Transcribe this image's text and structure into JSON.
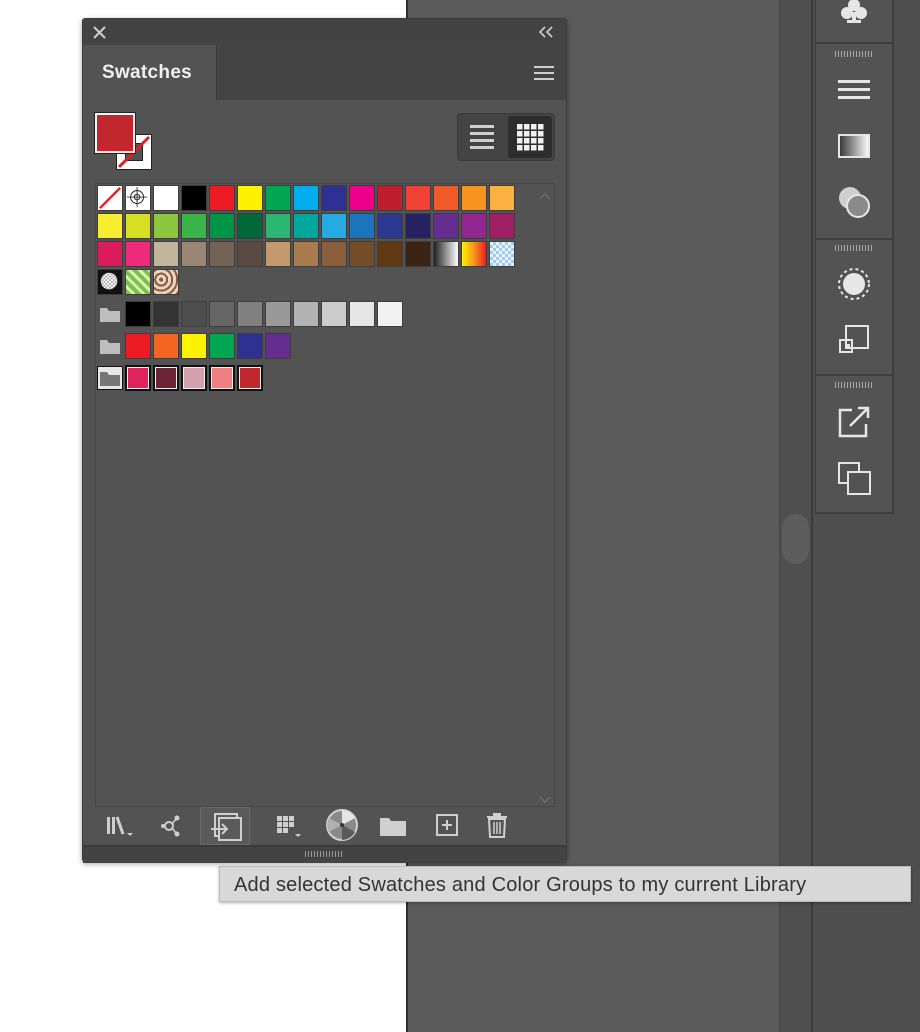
{
  "panel": {
    "title": "Swatches",
    "fill_color": "#c1272d",
    "stroke": "none"
  },
  "swatch_rows": [
    {
      "kind": "swatches",
      "colors": [
        "none",
        "registration",
        "#ffffff",
        "#000000",
        "#ed1c24",
        "#fff200",
        "#00a651",
        "#00aeef",
        "#2e3192",
        "#ec008c",
        "#be1e2d",
        "#ef4136",
        "#f15a29",
        "#f7941d",
        "#fbb040"
      ]
    },
    {
      "kind": "swatches",
      "colors": [
        "#f9ed32",
        "#d7df23",
        "#8dc63f",
        "#39b54a",
        "#009444",
        "#006838",
        "#2bb673",
        "#00a79d",
        "#27aae1",
        "#1c75bc",
        "#2b3990",
        "#262262",
        "#662d91",
        "#92278f",
        "#9e1f63"
      ]
    },
    {
      "kind": "swatches",
      "colors": [
        "#da1c5c",
        "#ee2a7b",
        "#c2b59b",
        "#998675",
        "#736357",
        "#594a42",
        "#c49a6c",
        "#a97c50",
        "#8b5e3c",
        "#754c29",
        "#603913",
        "#3c2415",
        "grad-bw",
        "grad-orange",
        "grad-blue"
      ]
    },
    {
      "kind": "patterns",
      "colors": [
        "pattern-check",
        "pattern-leaf",
        "pattern-swirl"
      ]
    },
    {
      "kind": "group",
      "colors": [
        "#000000",
        "#333333",
        "#4d4d4d",
        "#666666",
        "#808080",
        "#999999",
        "#b3b3b3",
        "#cccccc",
        "#e6e6e6",
        "#f2f2f2"
      ]
    },
    {
      "kind": "group",
      "colors": [
        "#ed1c24",
        "#f26522",
        "#fff200",
        "#00a651",
        "#2e3192",
        "#662d91"
      ]
    },
    {
      "kind": "group-selected",
      "colors": [
        "#e0245e",
        "#6b2335",
        "#d4a0ad",
        "#f08080",
        "#c1272d"
      ]
    }
  ],
  "tooltip": {
    "text": "Add selected Swatches and Color Groups to my current Library"
  },
  "icons": {
    "close": "close-icon",
    "collapse": "double-chevron-left-icon",
    "menu": "hamburger-menu-icon",
    "list_view": "list-view-icon",
    "grid_view": "grid-view-icon",
    "libraries": "libraries-menu-icon",
    "kuler": "color-themes-icon",
    "add_to_library": "add-to-library-icon",
    "show_kinds": "swatch-kinds-menu-icon",
    "swatch_options": "swatch-options-icon",
    "new_group": "new-color-group-icon",
    "new_swatch": "new-swatch-icon",
    "delete": "delete-icon"
  }
}
